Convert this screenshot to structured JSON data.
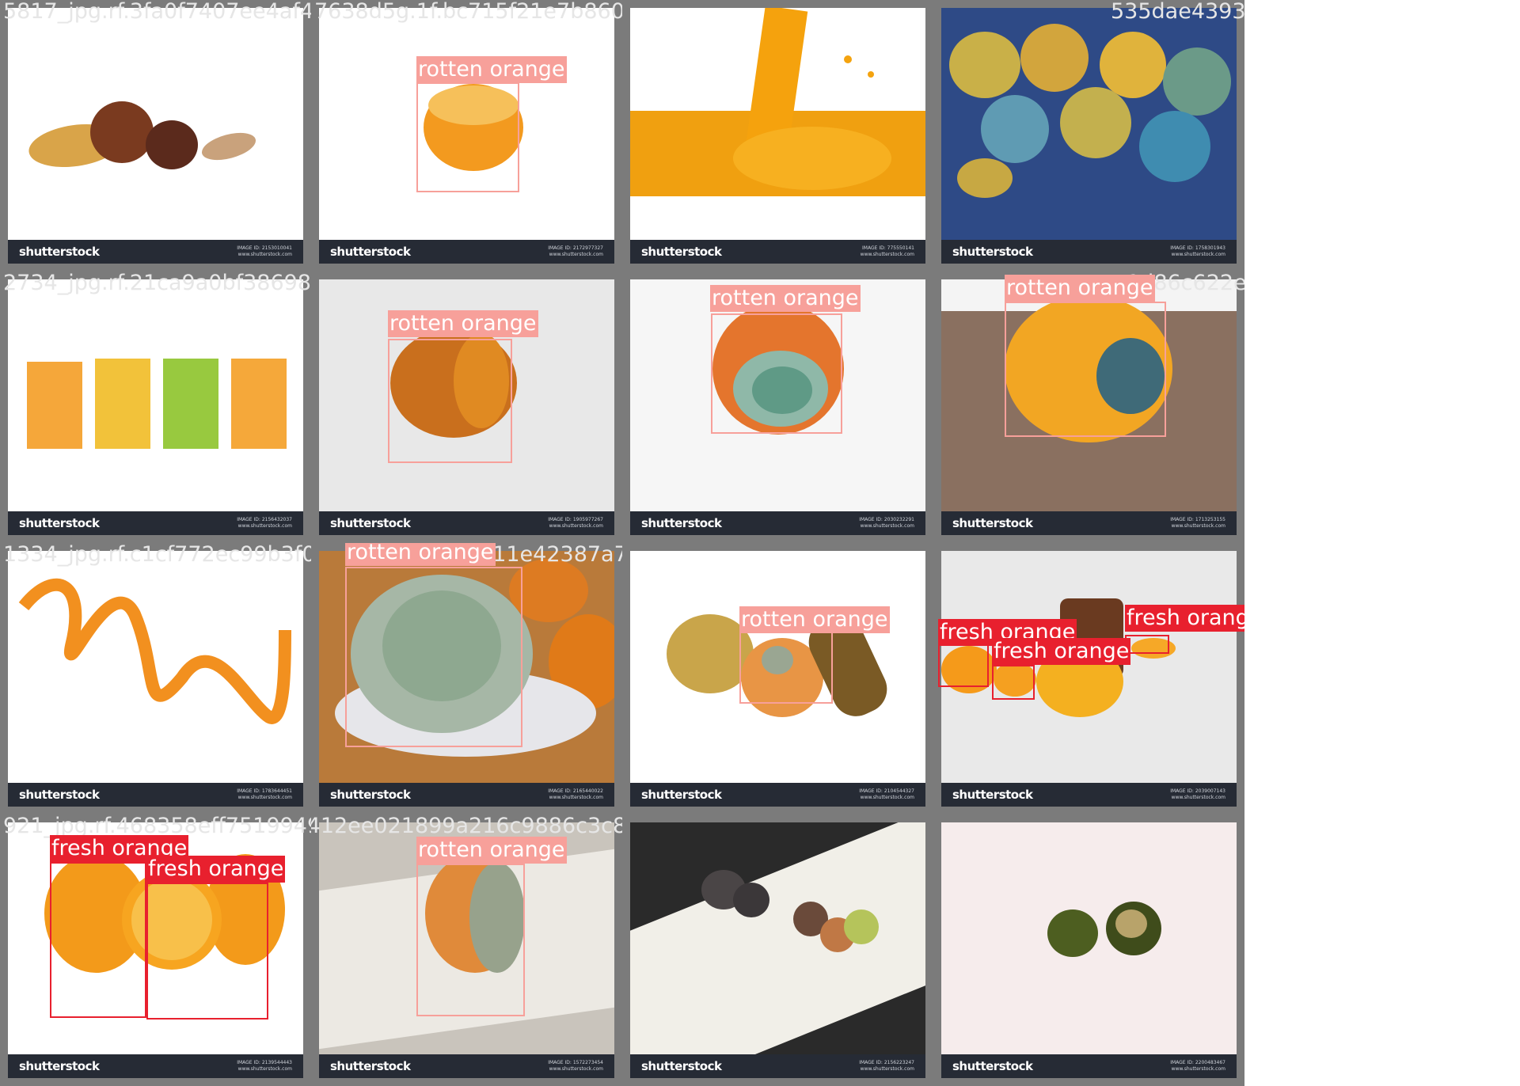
{
  "brand": "shutterstock",
  "label_colors": {
    "rotten orange": "#f7a09a",
    "fresh orange": "#e8202e"
  },
  "cells": [
    {
      "filename": "5817_jpg.rf.3fa0f7407ee4af41241f7728"
    },
    {
      "filename": "7638d5g.1f.bc715f21e7b860548bc4898eitbfef.24dfbae57e4644b932a2609jp414f9"
    },
    {
      "filename": ""
    },
    {
      "filename": "535dae439356edf7e"
    },
    {
      "filename": "2734_jpg.rf.21ca9a0bf38698fbb9f67f02bc6c.1f8993f90b36f3ff354ba6a6f2ed"
    },
    {
      "filename": ""
    },
    {
      "filename": ""
    },
    {
      "filename": "1d86c622e1"
    },
    {
      "filename": "1334_jpg.rf.c1cf772ec99b3f0f5fb9682"
    },
    {
      "filename": "5c811e42387a7a8225e5p9fa3c54792341ad049ba8370c46e7e29b75fddc78c543dfa"
    },
    {
      "filename": ""
    },
    {
      "filename": ""
    },
    {
      "filename": "921_jpg.rf.468358eff751994912d2682"
    },
    {
      "filename": "6bae4412ee021899a216c9886c3c8cc9f4e42666cd71d26cd1a8d2427_jpg_5bedeb6e00a274d52"
    },
    {
      "filename": ""
    },
    {
      "filename": ""
    }
  ],
  "boxes": [
    {
      "label": "rotten orange"
    },
    {
      "label": "rotten orange"
    },
    {
      "label": "rotten orange"
    },
    {
      "label": "rotten orange"
    },
    {
      "label": "rotten orange"
    },
    {
      "label": "rotten orange"
    },
    {
      "label": "fresh orange"
    },
    {
      "label": "fresh orange"
    },
    {
      "label": "fresh orange"
    },
    {
      "label": "fresh orange"
    },
    {
      "label": "fresh orange"
    },
    {
      "label": "rotten orange"
    }
  ]
}
